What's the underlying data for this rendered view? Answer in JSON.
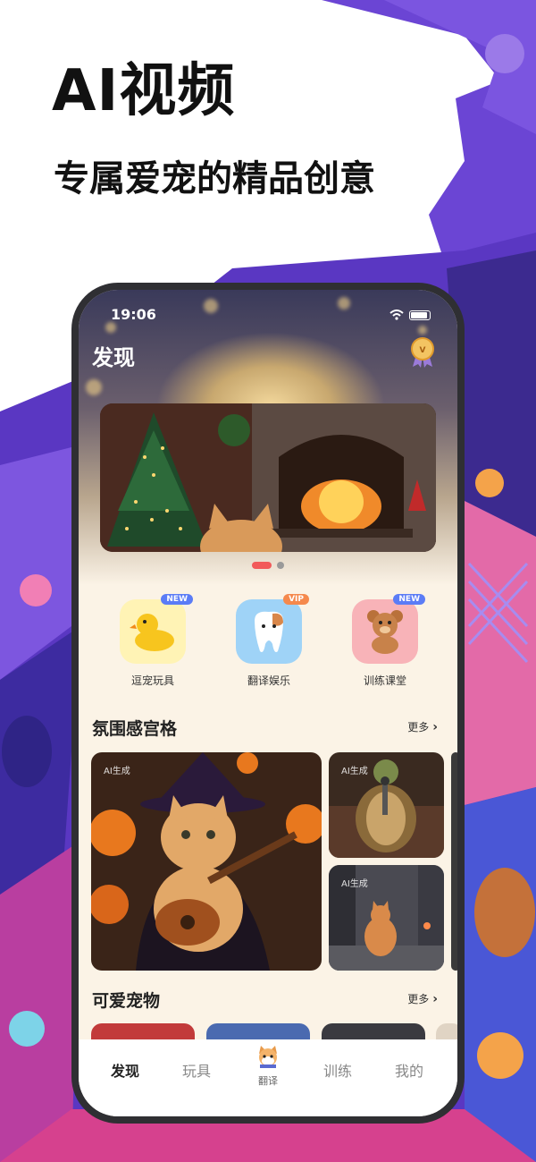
{
  "promo": {
    "headline": "AI视频",
    "subline": "专属爱宠的精品创意"
  },
  "status_bar": {
    "time": "19:06"
  },
  "header": {
    "title": "发现",
    "medal_icon": "medal-icon"
  },
  "banner": {
    "page_count": 2,
    "active_page": 1
  },
  "features": [
    {
      "label": "逗宠玩具",
      "badge": "NEW",
      "badge_color": "#5b7cf6",
      "tile_color": "#fff3b5",
      "icon": "duck-icon"
    },
    {
      "label": "翻译娱乐",
      "badge": "VIP",
      "badge_color": "#f5894d",
      "tile_color": "#9fd3f7",
      "icon": "tooth-pet-icon"
    },
    {
      "label": "训练课堂",
      "badge": "NEW",
      "badge_color": "#5b7cf6",
      "tile_color": "#f8b3b8",
      "icon": "teddy-bear-icon"
    }
  ],
  "section_atmosphere": {
    "title": "氛围感宫格",
    "more": "更多",
    "cards": [
      {
        "tag": "AI生成",
        "icon": "cat-guitar-image"
      },
      {
        "tag": "AI生成",
        "icon": "turtle-singer-image"
      },
      {
        "tag": "AI生成",
        "icon": "cat-street-image"
      }
    ]
  },
  "section_pets": {
    "title": "可爱宠物",
    "more": "更多"
  },
  "tabbar": {
    "tabs": [
      {
        "label": "发现",
        "active": true
      },
      {
        "label": "玩具",
        "active": false
      },
      {
        "label": "翻译",
        "active": false,
        "icon": "cat-face-icon"
      },
      {
        "label": "训练",
        "active": false
      },
      {
        "label": "我的",
        "active": false
      }
    ]
  },
  "colors": {
    "accent_red": "#f25a5a",
    "screen_bg": "#fbf3e6",
    "promo_purple": "#6a3fc8"
  }
}
